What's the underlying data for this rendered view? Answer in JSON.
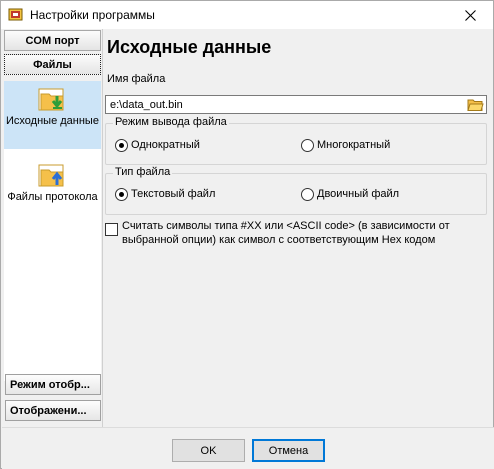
{
  "window": {
    "title": "Настройки программы"
  },
  "sidebar": {
    "com_port_label": "COM порт",
    "files_label": "Файлы",
    "nav_items": [
      {
        "label": "Исходные данные",
        "icon": "folder-download-icon",
        "selected": true
      },
      {
        "label": "Файлы протокола",
        "icon": "folder-upload-icon",
        "selected": false
      }
    ],
    "display_mode_label": "Режим отобр...",
    "display_label": "Отображени..."
  },
  "main": {
    "title": "Исходные данные",
    "file_name_label": "Имя файла",
    "file_name_value": "e:\\data_out.bin",
    "output_mode": {
      "title": "Режим вывода файла",
      "options": [
        "Однократный",
        "Многократный"
      ],
      "selected": "Однократный"
    },
    "file_type": {
      "title": "Тип файла",
      "options": [
        "Текстовый файл",
        "Двоичный файл"
      ],
      "selected": "Текстовый файл"
    },
    "hex_checkbox": {
      "checked": false,
      "label": "Считать символы типа #XX или <ASCII code> (в зависимости от выбранной опции) как символ с соответствующим Hex кодом"
    }
  },
  "footer": {
    "ok_label": "OK",
    "cancel_label": "Отмена"
  },
  "colors": {
    "selection": "#cce4f7",
    "accent": "#0078d7",
    "folder": "#f5c04a",
    "arrow_green": "#2e9e3a",
    "arrow_blue": "#2b6fd6"
  }
}
